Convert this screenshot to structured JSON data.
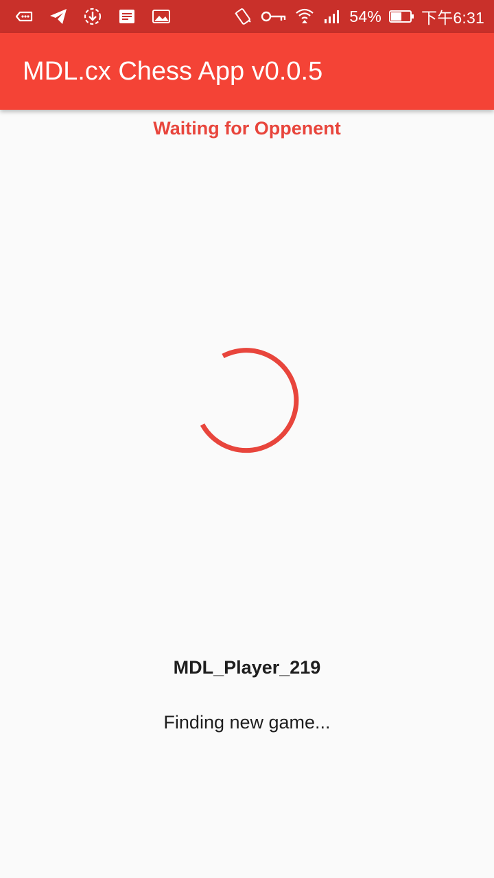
{
  "status_bar": {
    "left_icons": [
      "message-icon",
      "telegram-icon",
      "download-icon",
      "news-icon",
      "image-icon"
    ],
    "right_icons": [
      "vibrate-icon",
      "key-icon",
      "wifi-icon",
      "signal-icon",
      "battery-icon"
    ],
    "battery_percent": "54%",
    "time": "下午6:31",
    "background": "#c9302a"
  },
  "app_bar": {
    "title": "MDL.cx Chess App v0.0.5",
    "background": "#f44336"
  },
  "main": {
    "status_text": "Waiting for Oppenent",
    "status_color": "#e8453c",
    "spinner_color": "#e8453c",
    "player_name": "MDL_Player_219",
    "finding_text": "Finding new game..."
  }
}
